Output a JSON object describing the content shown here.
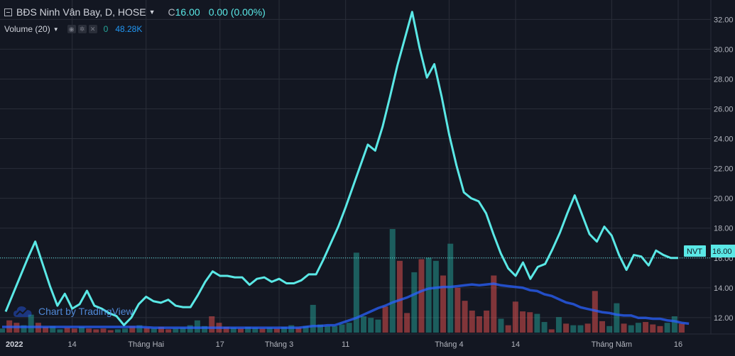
{
  "legend": {
    "symbol_title": "BĐS Ninh Vân Bay, D, HOSE",
    "close_label": "C",
    "close_value": "16.00",
    "change": "0.00 (0.00%)"
  },
  "volume_legend": {
    "title": "Volume (20)",
    "value_1": "0",
    "value_2": "48.28K"
  },
  "watermark": {
    "text": "Chart by TradingView"
  },
  "price_tag": {
    "label": "NVT",
    "value": "16.00"
  },
  "icons": {
    "collapse": "collapse-icon",
    "dropdown": "caret-down-icon",
    "settings": "gear-icon",
    "visibility": "eye-icon",
    "remove": "close-icon",
    "watermark": "tradingview-cloud-icon"
  },
  "colors": {
    "background": "#131722",
    "grid": "#2a2e39",
    "line": "#5ae8e6",
    "volume_up": "#26a69a",
    "volume_down": "#ef5350",
    "volume_ma": "#2962ff",
    "text": "#b2b5be"
  },
  "chart_data": {
    "type": "line",
    "title": "BĐS Ninh Vân Bay, D, HOSE",
    "x_tick_labels": [
      "2022",
      "14",
      "Tháng Hai",
      "17",
      "Tháng 3",
      "11",
      "Tháng 4",
      "14",
      "Tháng Năm",
      "16"
    ],
    "y_tick_labels": [
      "12.00",
      "14.00",
      "16.00",
      "18.00",
      "20.00",
      "22.00",
      "24.00",
      "26.00",
      "28.00",
      "30.00",
      "32.00"
    ],
    "ylim": [
      10.9,
      33.3
    ],
    "grid": true,
    "price_line": 16.0,
    "series": [
      {
        "name": "NVT",
        "values": [
          12.4,
          13.6,
          14.8,
          16.0,
          17.1,
          15.6,
          14.1,
          12.8,
          13.6,
          12.6,
          12.9,
          13.8,
          12.8,
          12.6,
          12.3,
          12.1,
          11.5,
          12.0,
          12.9,
          13.4,
          13.1,
          13.0,
          13.2,
          12.8,
          12.7,
          12.7,
          13.5,
          14.4,
          15.1,
          14.8,
          14.8,
          14.7,
          14.7,
          14.2,
          14.6,
          14.7,
          14.4,
          14.6,
          14.3,
          14.3,
          14.5,
          14.9,
          14.9,
          15.9,
          17.0,
          18.1,
          19.4,
          20.8,
          22.2,
          23.6,
          23.2,
          24.8,
          26.8,
          28.9,
          30.7,
          32.5,
          30.1,
          28.1,
          29.0,
          26.8,
          24.3,
          22.2,
          20.4,
          20.0,
          19.8,
          19.0,
          17.6,
          16.3,
          15.3,
          14.8,
          15.7,
          14.6,
          15.4,
          15.6,
          16.6,
          17.7,
          19.0,
          20.2,
          18.9,
          17.6,
          17.1,
          18.1,
          17.5,
          16.2,
          15.2,
          16.2,
          16.1,
          15.5,
          16.5,
          16.2,
          16.0,
          16.0
        ]
      }
    ],
    "volume": {
      "name": "Volume",
      "values": [
        0.05,
        0.15,
        0.12,
        0.09,
        0.22,
        0.12,
        0.07,
        0.08,
        0.04,
        0.06,
        0.05,
        0.07,
        0.05,
        0.04,
        0.05,
        0.03,
        0.04,
        0.05,
        0.08,
        0.09,
        0.06,
        0.05,
        0.07,
        0.04,
        0.05,
        0.06,
        0.09,
        0.15,
        0.08,
        0.2,
        0.12,
        0.07,
        0.06,
        0.05,
        0.07,
        0.06,
        0.05,
        0.06,
        0.05,
        0.07,
        0.09,
        0.06,
        0.08,
        0.34,
        0.1,
        0.08,
        0.08,
        0.1,
        0.12,
        0.98,
        0.2,
        0.18,
        0.16,
        0.32,
        1.27,
        0.88,
        0.24,
        0.74,
        0.9,
        0.92,
        0.88,
        0.7,
        1.09,
        0.55,
        0.39,
        0.27,
        0.2,
        0.27,
        0.7,
        0.17,
        0.09,
        0.38,
        0.26,
        0.25,
        0.23,
        0.13,
        0.04,
        0.19,
        0.11,
        0.09,
        0.09,
        0.11,
        0.51,
        0.14,
        0.08,
        0.36,
        0.11,
        0.09,
        0.12,
        0.13,
        0.1,
        0.08,
        0.12,
        0.2,
        0.11
      ],
      "direction": [
        1,
        0,
        0,
        1,
        1,
        0,
        0,
        1,
        1,
        0,
        0,
        1,
        0,
        0,
        0,
        0,
        1,
        1,
        0,
        1,
        0,
        1,
        0,
        0,
        1,
        1,
        1,
        1,
        1,
        0,
        0,
        0,
        1,
        0,
        1,
        1,
        0,
        1,
        0,
        1,
        1,
        0,
        1,
        1,
        1,
        1,
        1,
        1,
        1,
        1,
        1,
        1,
        1,
        0,
        1,
        0,
        0,
        1,
        0,
        1,
        1,
        0,
        1,
        0,
        0,
        0,
        0,
        0,
        0,
        1,
        0,
        0,
        0,
        0,
        1,
        1,
        0,
        1,
        0,
        1,
        1,
        0,
        0,
        0,
        1,
        1,
        0,
        1,
        1,
        0,
        0,
        0,
        1,
        1,
        0
      ],
      "ma_values": [
        0.07,
        0.07,
        0.07,
        0.07,
        0.07,
        0.07,
        0.07,
        0.07,
        0.07,
        0.07,
        0.07,
        0.07,
        0.07,
        0.07,
        0.07,
        0.07,
        0.07,
        0.07,
        0.07,
        0.07,
        0.065,
        0.06,
        0.06,
        0.06,
        0.06,
        0.06,
        0.06,
        0.06,
        0.06,
        0.06,
        0.06,
        0.06,
        0.06,
        0.06,
        0.06,
        0.06,
        0.06,
        0.06,
        0.06,
        0.06,
        0.06,
        0.06,
        0.07,
        0.08,
        0.08,
        0.09,
        0.09,
        0.12,
        0.15,
        0.18,
        0.22,
        0.26,
        0.3,
        0.33,
        0.37,
        0.4,
        0.43,
        0.47,
        0.51,
        0.54,
        0.55,
        0.56,
        0.56,
        0.57,
        0.58,
        0.59,
        0.58,
        0.59,
        0.6,
        0.58,
        0.57,
        0.56,
        0.55,
        0.52,
        0.51,
        0.47,
        0.45,
        0.41,
        0.37,
        0.35,
        0.31,
        0.29,
        0.27,
        0.25,
        0.24,
        0.22,
        0.21,
        0.21,
        0.18,
        0.18,
        0.17,
        0.17,
        0.15,
        0.14,
        0.12,
        0.11
      ]
    }
  }
}
